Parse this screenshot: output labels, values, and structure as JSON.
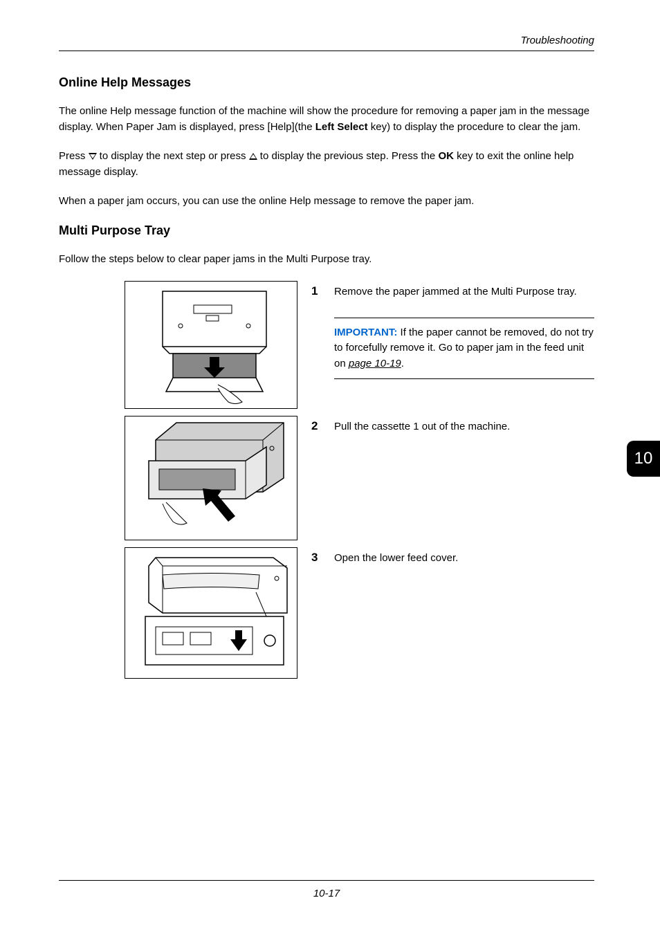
{
  "header": {
    "section_title": "Troubleshooting"
  },
  "section1": {
    "heading": "Online Help Messages",
    "para1_a": "The online Help message function of the machine will show the procedure for removing a paper jam in the message display. When Paper Jam is displayed, press [Help](the ",
    "para1_bold1": "Left Select",
    "para1_b": " key) to display the procedure to clear the jam.",
    "para2_a": "Press ",
    "para2_b": " to display the next step or press ",
    "para2_c": " to display the previous step. Press the ",
    "para2_bold1": "OK",
    "para2_d": " key to exit the online help message display.",
    "para3": "When a paper jam occurs, you can use the online Help message to remove the paper jam."
  },
  "section2": {
    "heading": "Multi Purpose Tray",
    "intro": "Follow the steps below to clear paper jams in the Multi Purpose tray.",
    "steps": [
      {
        "num": "1",
        "text": "Remove the paper jammed at the Multi Purpose tray."
      },
      {
        "num": "2",
        "text": "Pull the cassette 1 out of the machine."
      },
      {
        "num": "3",
        "text": "Open the lower feed cover."
      }
    ],
    "important": {
      "label": "IMPORTANT:",
      "text_a": " If the paper cannot be removed, do not try to forcefully remove it. Go to paper jam in the feed unit on ",
      "link": "page 10-19",
      "text_b": "."
    }
  },
  "chapter_number": "10",
  "page_number": "10-17"
}
